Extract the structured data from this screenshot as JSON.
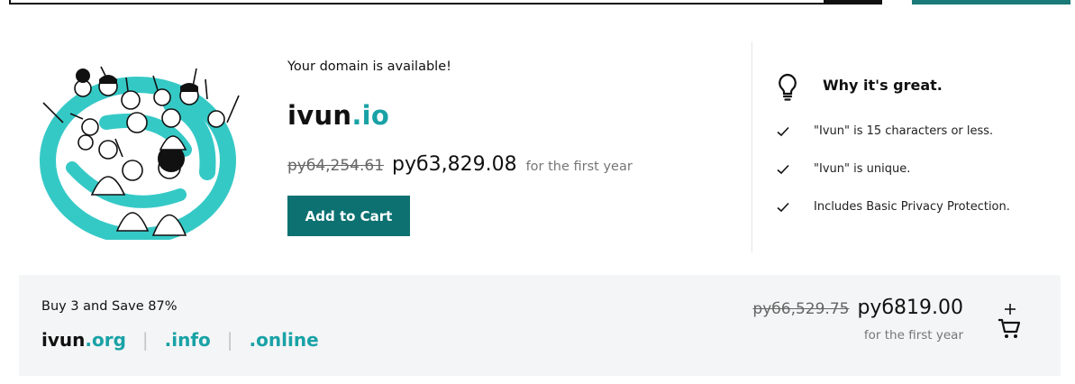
{
  "main": {
    "availability_text": "Your domain is available!",
    "domain_sld": "ivun",
    "domain_tld": ".io",
    "old_price": "руб4,254.61",
    "new_price": "руб3,829.08",
    "period": "for the first year",
    "add_to_cart_label": "Add to Cart"
  },
  "why": {
    "title": "Why it's great.",
    "reasons": [
      "\"Ivun\" is 15 characters or less.",
      "\"Ivun\" is unique.",
      "Includes Basic Privacy Protection."
    ]
  },
  "bundle": {
    "title": "Buy 3 and Save 87%",
    "domains": [
      {
        "sld": "ivun",
        "tld": ".org"
      },
      {
        "sld": "",
        "tld": ".info"
      },
      {
        "sld": "",
        "tld": ".online"
      }
    ],
    "old_price": "руб6,529.75",
    "new_price": "руб819.00",
    "period": "for the first year"
  },
  "icons": {
    "lightbulb": "lightbulb-icon",
    "check": "checkmark-icon",
    "cart_add": "add-to-cart-icon"
  },
  "colors": {
    "accent_teal": "#19a2a6",
    "button_teal": "#0d7171",
    "bundle_bg": "#f4f5f6"
  }
}
